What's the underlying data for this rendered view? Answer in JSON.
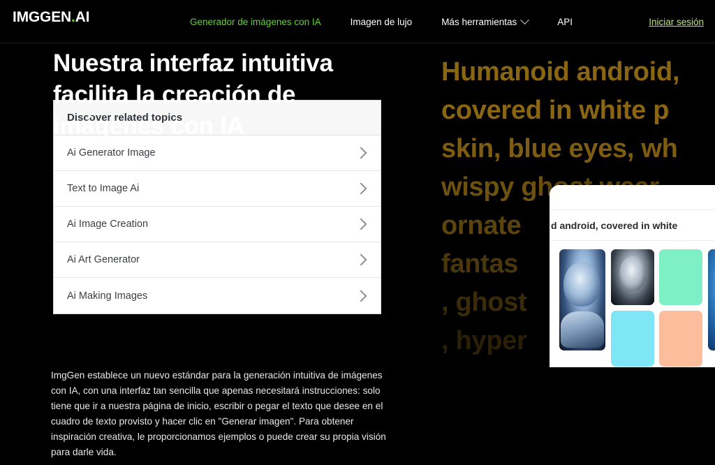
{
  "navbar": {
    "logo_main": "IMGGEN",
    "logo_dot": ".",
    "logo_suffix": "AI",
    "links": [
      {
        "label": "Generador de imágenes con IA",
        "active": true
      },
      {
        "label": "Imagen de lujo",
        "active": false
      },
      {
        "label": "Más herramientas",
        "active": false,
        "has_caret": true
      },
      {
        "label": "API",
        "active": false
      }
    ],
    "login_label": "Iniciar sesión",
    "active_color": "#5dd62c",
    "login_color": "#bde37a"
  },
  "hero": {
    "headline": "Nuestra interfaz intuitiva facilita la creación de imágenes con IA",
    "paragraph": "ImgGen establece un nuevo estándar para la generación intuitiva de imágenes con IA, con una interfaz tan sencilla que apenas necesitará instrucciones: solo tiene que ir a nuestra página de inicio, escribir o pegar el texto que desee en el cuadro de texto provisto y hacer clic en \"Generar imagen\". Para obtener inspiración creativa, le proporcionamos ejemplos o puede crear su propia visión para darle vida."
  },
  "topics_card": {
    "header": "Discover related topics",
    "items": [
      {
        "label": "Ai Generator Image"
      },
      {
        "label": "Text to Image Ai"
      },
      {
        "label": "Ai Image Creation"
      },
      {
        "label": "Ai Art Generator"
      },
      {
        "label": "Ai Making Images"
      }
    ]
  },
  "background_prompt": {
    "lines": [
      "Humanoid android,",
      "covered in white p",
      "skin, blue eyes, wh",
      "wispy ghost wear",
      "ornate",
      "fantas",
      ", ghost",
      ", hyper"
    ],
    "color": "#8a6613"
  },
  "app_panel": {
    "prompt_text": "d android, covered in white",
    "thumbnails": [
      {
        "name": "android-portrait-tall",
        "kind": "image"
      },
      {
        "name": "grayscale-android-face",
        "kind": "image"
      },
      {
        "name": "mint-placeholder",
        "kind": "color",
        "color": "#7ff0c6"
      },
      {
        "name": "blue-android-portrait",
        "kind": "image"
      },
      {
        "name": "cyan-placeholder",
        "kind": "color",
        "color": "#7fe6f5"
      },
      {
        "name": "peach-placeholder",
        "kind": "color",
        "color": "#fbbd9b"
      }
    ]
  }
}
